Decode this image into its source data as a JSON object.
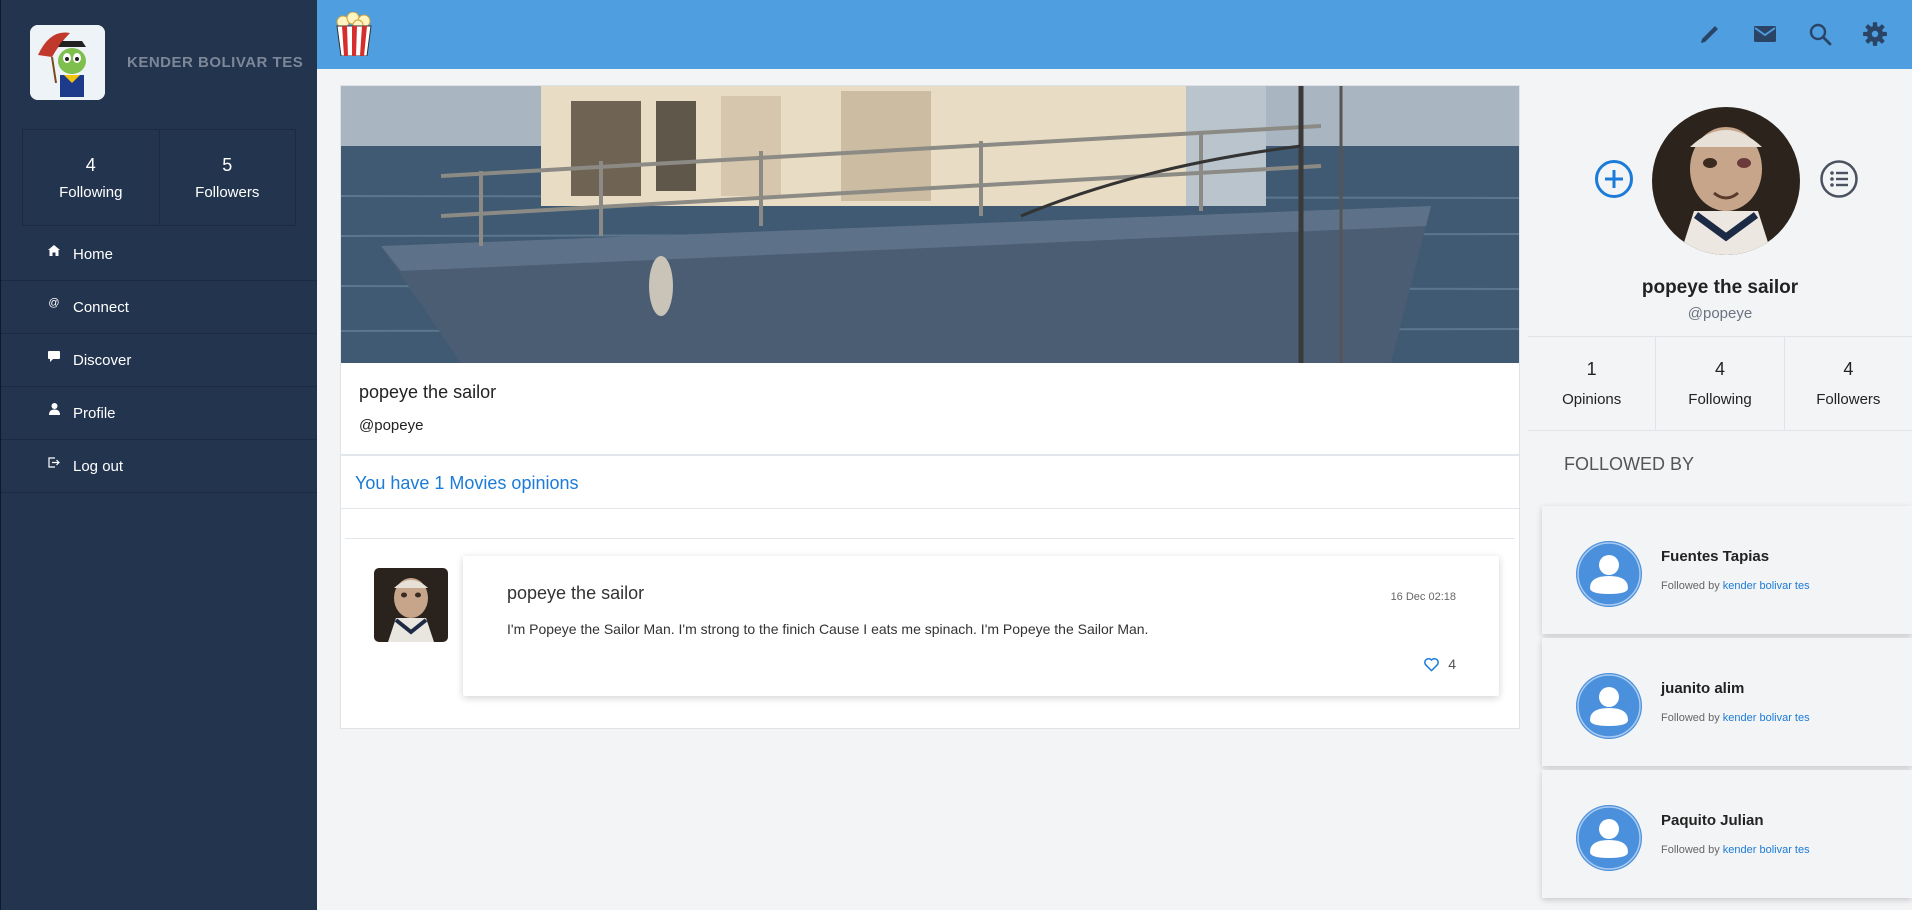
{
  "user": {
    "name": "KENDER BOLIVAR TES",
    "following_count": "4",
    "following_label": "Following",
    "followers_count": "5",
    "followers_label": "Followers"
  },
  "nav": {
    "items": [
      {
        "label": "Home",
        "icon": "home-icon"
      },
      {
        "label": "Connect",
        "icon": "at-icon"
      },
      {
        "label": "Discover",
        "icon": "chat-icon"
      },
      {
        "label": "Profile",
        "icon": "person-icon"
      },
      {
        "label": "Log out",
        "icon": "logout-icon"
      }
    ]
  },
  "topbar": {
    "logo": "popcorn-icon",
    "icons": [
      "pencil-icon",
      "mail-icon",
      "search-icon",
      "gear-icon"
    ],
    "color": "#4f9fe0"
  },
  "profile": {
    "name": "popeye the sailor",
    "handle": "@popeye",
    "opinions_link": "You have 1 Movies opinions"
  },
  "post": {
    "author": "popeye the sailor",
    "date": "16 Dec 02:18",
    "text": "I'm Popeye the Sailor Man. I'm strong to the finich Cause I eats me spinach. I'm Popeye the Sailor Man.",
    "likes": "4"
  },
  "side": {
    "name": "popeye the sailor",
    "handle": "@popeye",
    "stats": [
      {
        "num": "1",
        "label": "Opinions"
      },
      {
        "num": "4",
        "label": "Following"
      },
      {
        "num": "4",
        "label": "Followers"
      }
    ],
    "followed_by_title": "FOLLOWED BY",
    "followed_by": [
      {
        "name": "Fuentes Tapias",
        "prefix": "Followed by",
        "link": "kender bolivar tes"
      },
      {
        "name": "juanito alim",
        "prefix": "Followed by",
        "link": "kender bolivar tes"
      },
      {
        "name": "Paquito Julian",
        "prefix": "Followed by",
        "link": "kender bolivar tes"
      }
    ]
  },
  "colors": {
    "sidebar": "#23344e",
    "accent": "#1b7bd8",
    "background": "#f3f4f6"
  }
}
